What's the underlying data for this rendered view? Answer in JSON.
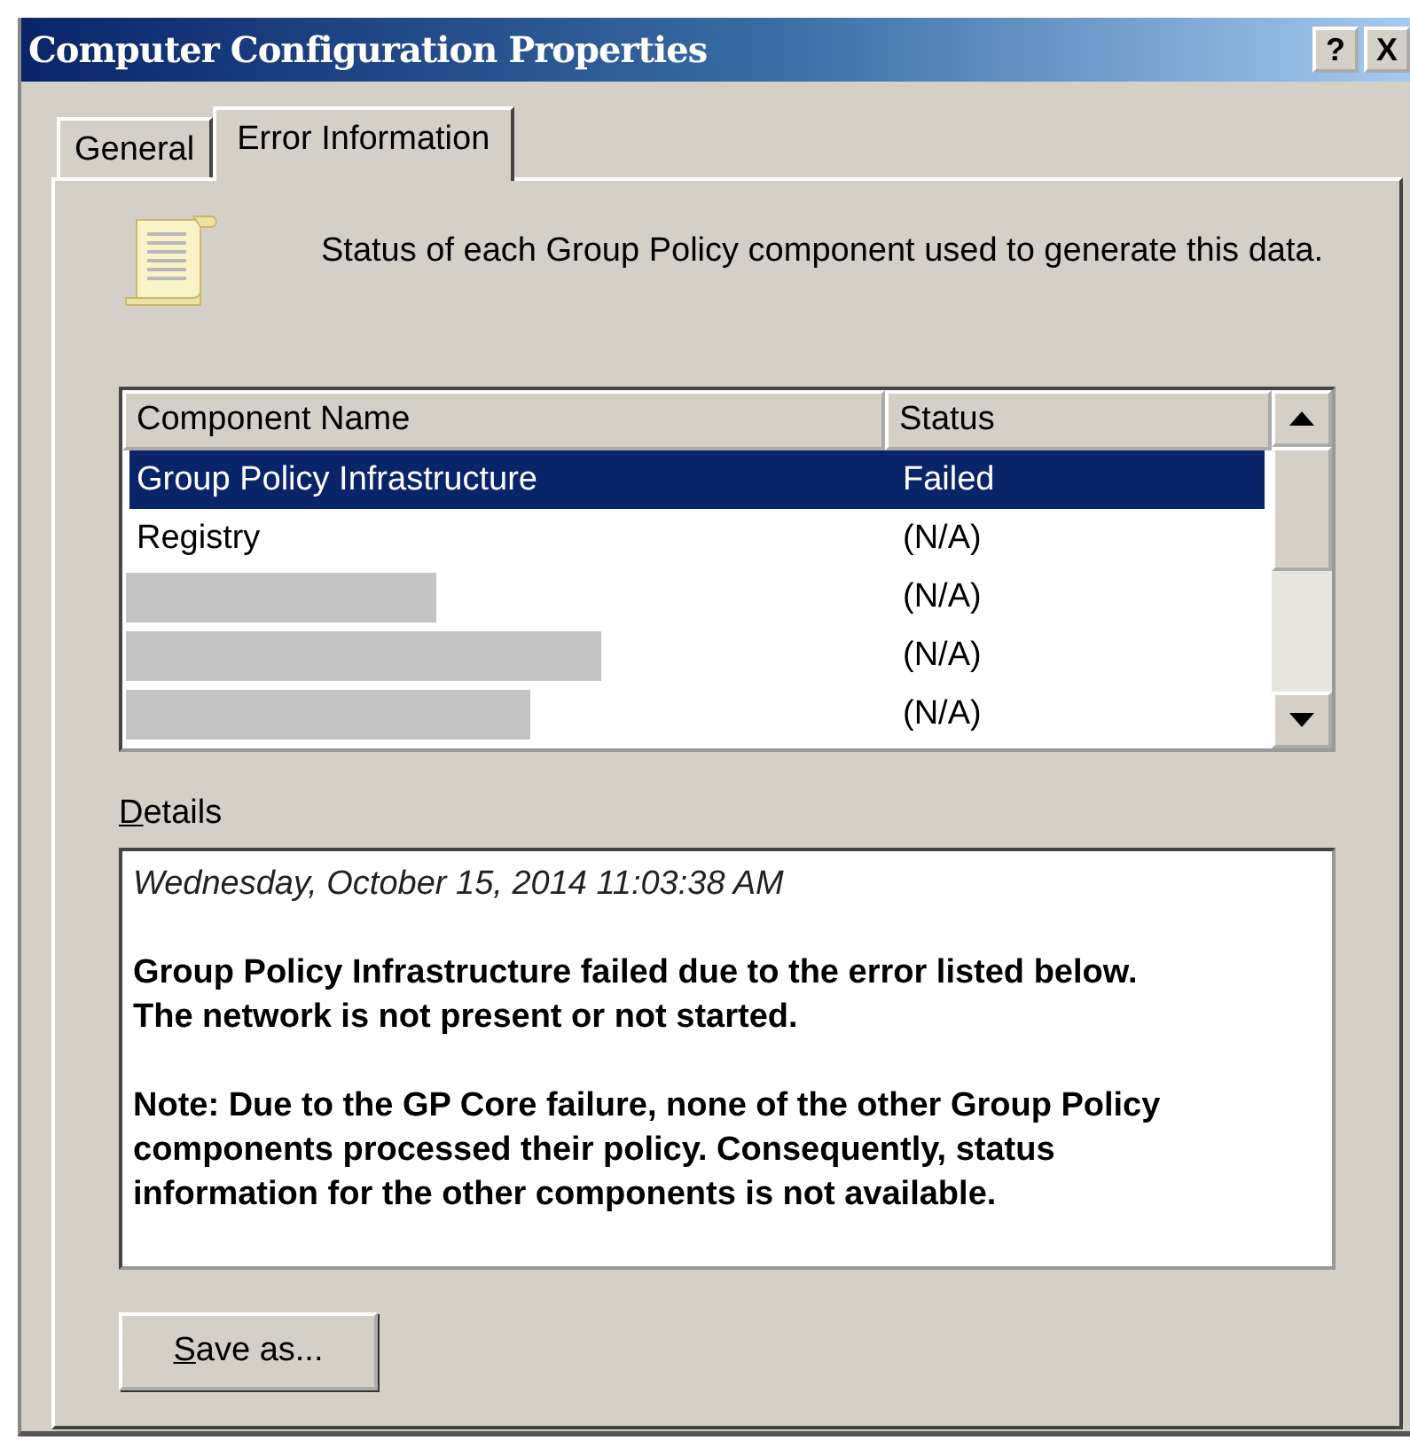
{
  "window": {
    "title": "Computer Configuration Properties",
    "title_buttons": [
      "?",
      "X"
    ]
  },
  "tabs": [
    {
      "label": "General",
      "selected": false
    },
    {
      "label": "Error Information",
      "selected": true
    }
  ],
  "description": "Status of each Group Policy component used to generate this data.",
  "table": {
    "columns": [
      "Component Name",
      "Status"
    ],
    "rows": [
      {
        "kind": "text",
        "name": "Group Policy Infrastructure",
        "status": "Failed",
        "selected": true
      },
      {
        "kind": "text",
        "name": "Registry",
        "status": "(N/A)",
        "selected": false
      },
      {
        "kind": "redacted",
        "status": "(N/A)",
        "selected": false
      },
      {
        "kind": "redacted",
        "status": "(N/A)",
        "selected": false
      },
      {
        "kind": "redacted",
        "status": "(N/A)",
        "selected": false
      }
    ]
  },
  "details": {
    "label": "Details",
    "paragraphs": [
      {
        "kind": "timestamp",
        "text": "Wednesday, October 15, 2014 11:03:38 AM"
      },
      {
        "kind": "error",
        "text": "Group Policy Infrastructure failed due to the error listed below."
      },
      {
        "kind": "continued",
        "text": "The network is not present or not started."
      },
      {
        "kind": "error",
        "text": "Note:  Due to the GP Core failure, none of the other Group Policy components processed their policy.  Consequently, status information for the other components is not available."
      }
    ]
  },
  "buttons": [
    "Save as..."
  ]
}
